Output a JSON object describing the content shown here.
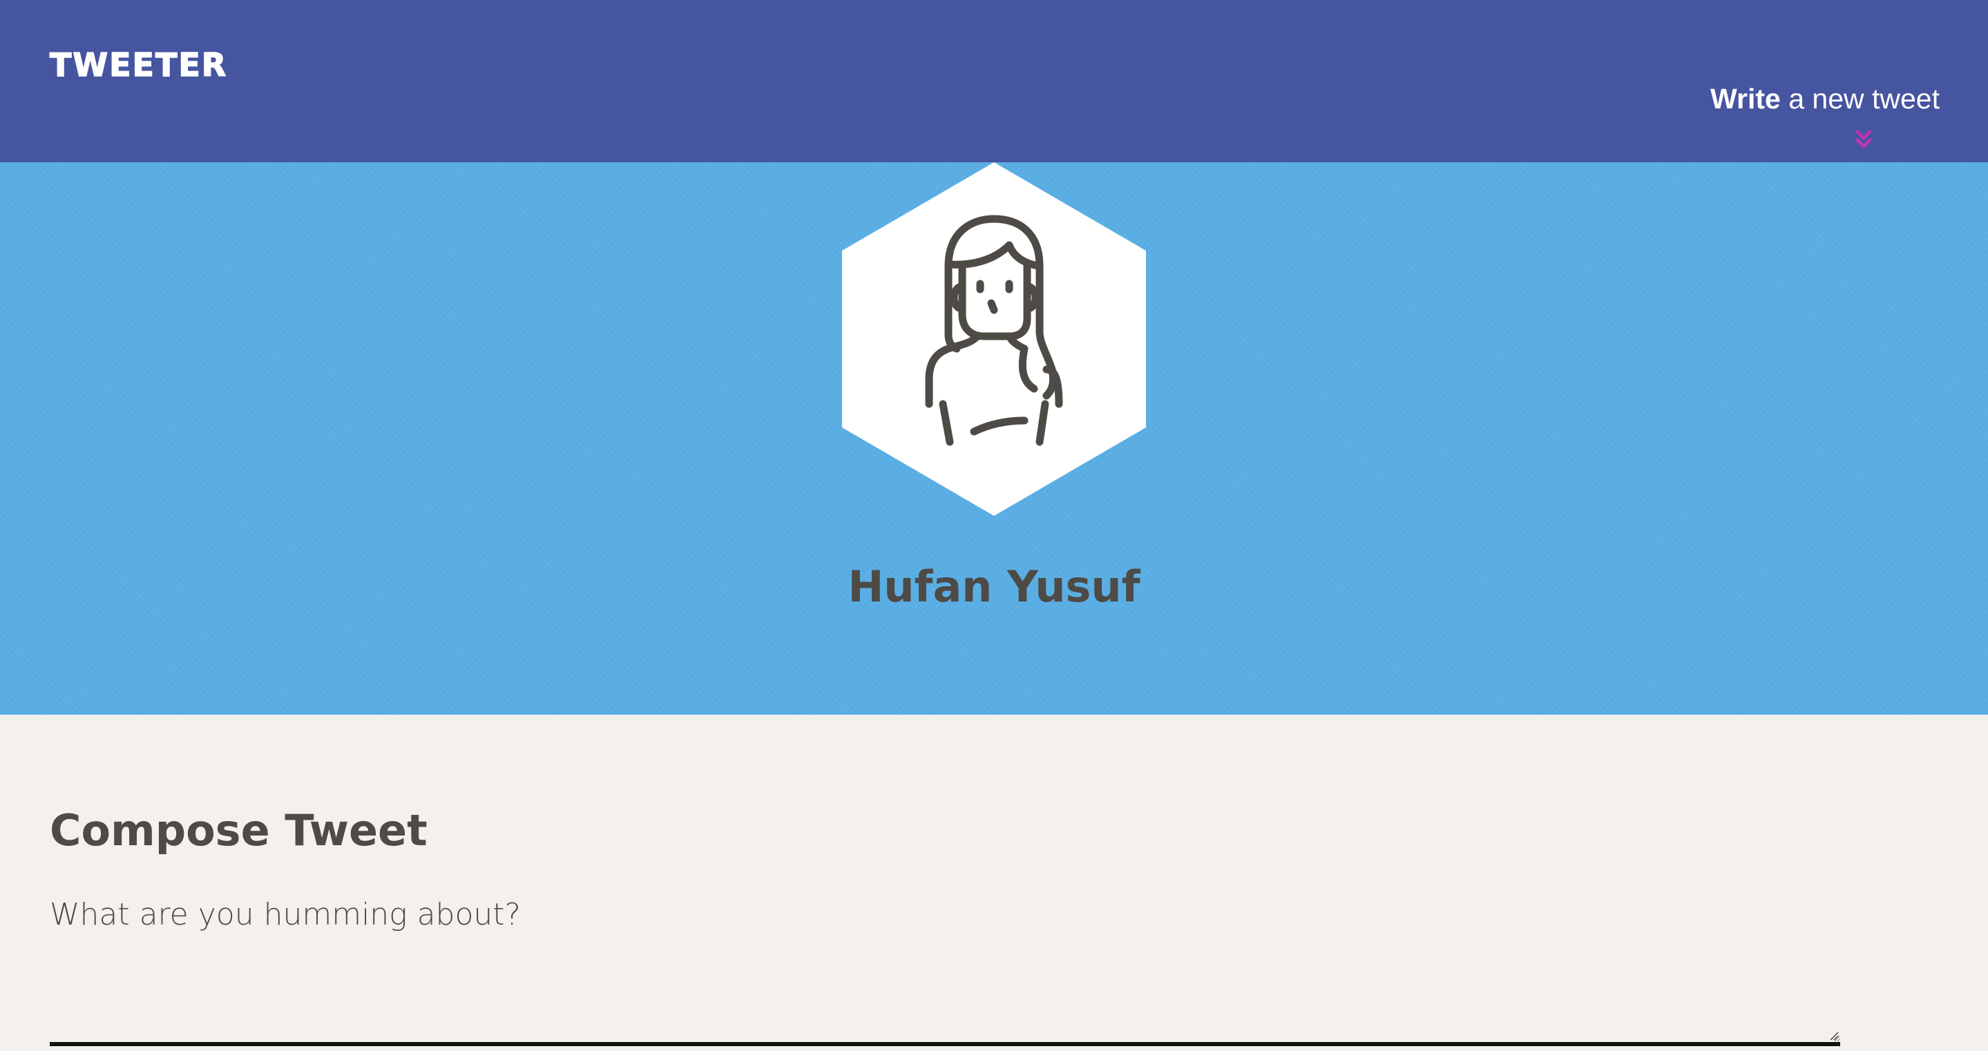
{
  "nav": {
    "brand": "TWEETER",
    "write_strong": "Write",
    "write_rest": " a new tweet",
    "chevron_icon": "double-chevron-down-icon",
    "chevron_color": "#c233b5"
  },
  "colors": {
    "nav_bg": "#4655a0",
    "hero_bg": "#5aaee4",
    "page_bg": "#f4f1ec",
    "text": "#4e4a45"
  },
  "profile": {
    "avatar_icon": "woman-avatar-icon",
    "name": "Hufan Yusuf"
  },
  "compose": {
    "title": "Compose Tweet",
    "placeholder": "What are you humming about?",
    "value": ""
  }
}
